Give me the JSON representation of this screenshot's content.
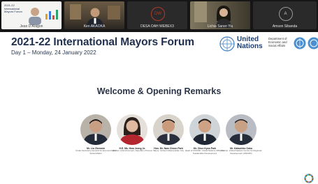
{
  "participants": [
    {
      "name": "Jean D'Aragon",
      "thumbnail": "mini slide",
      "thumbnail_text": "2021-22 International Mayors Forum"
    },
    {
      "name": "Ken AKAOKA",
      "thumbnail": "video"
    },
    {
      "name": "DESA OAH WEBEX3",
      "thumbnail": "initials",
      "initials": "DW"
    },
    {
      "name": "Lichia Saner-Yiu",
      "thumbnail": "video"
    },
    {
      "name": "Amson Sibanda",
      "thumbnail": "initials",
      "initials": "A"
    }
  ],
  "slide": {
    "title": "2021-22 International Mayors Forum",
    "subtitle": "Day 1 – Monday, 24 January 2022",
    "un_logo_text": "United Nations",
    "desa_text": "Department of Economic and Social Affairs",
    "section_title": "Welcome & Opening Remarks",
    "speakers": [
      {
        "name": "Mr. Liu Zhenmin",
        "role": "Under-Secretary-General for Economic and Social Affairs"
      },
      {
        "name": "H.E. Ms. Hwa Jeong Jo",
        "role": "Minister of Environment, Republic of Korea"
      },
      {
        "name": "Hon. Mr. Nam Cheon Park",
        "role": "Mayor, Incheon Metropolitan City"
      },
      {
        "name": "Mr. Chun Kyoo Park",
        "role": "Head of UNOSD, United Nations Office for Sustainable Development"
      },
      {
        "name": "Mr. Katsuhiko Ooka",
        "role": "Director, United Nations Centre for Regional Development (UNCRD)"
      }
    ]
  },
  "colors": {
    "topbar_bg": "#161616",
    "title": "#1f2f4d",
    "un_blue": "#1c3f74",
    "initials_ring": "#b23a2a"
  },
  "icons": [
    "un-emblem-icon",
    "desa-logo-icon",
    "sdg-wheel-icon"
  ]
}
